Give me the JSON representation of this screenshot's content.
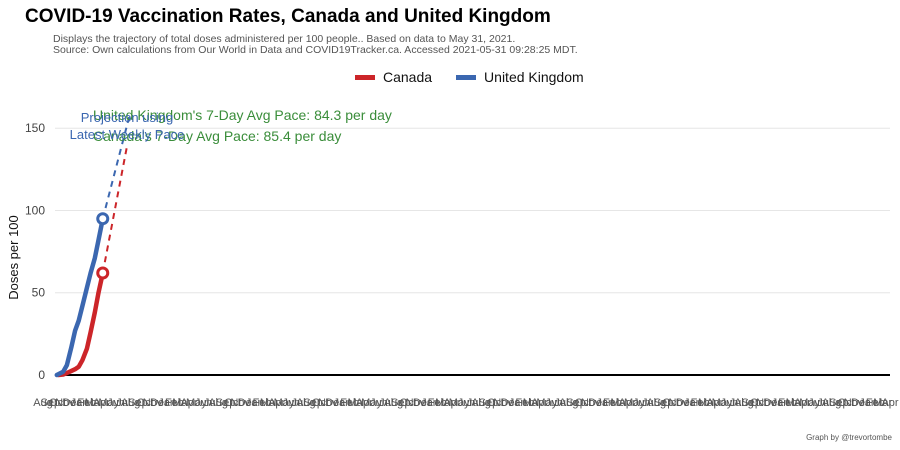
{
  "header": {
    "title": "COVID-19 Vaccination Rates, Canada and United Kingdom",
    "subtitle_line1": "Displays the trajectory of total doses administered per 100 people.. Based on data to May 31, 2021.",
    "subtitle_line2": "Source: Own calculations from Our World in Data and COVID19Tracker.ca. Accessed 2021-05-31 09:28:25 MDT."
  },
  "footer": {
    "caption": "Graph by @trevortombe"
  },
  "colors": {
    "canada": "#cc2529",
    "uk": "#3b67b0",
    "annotation": "#3a8d3a",
    "projection": "#3b67b0"
  },
  "chart_data": {
    "type": "line",
    "title": "COVID-19 Vaccination Rates, Canada and United Kingdom",
    "xlabel": "",
    "ylabel": "Doses per 100",
    "ylim": [
      0,
      155
    ],
    "y_ticks": [
      0,
      50,
      100,
      150
    ],
    "grid": true,
    "legend_position": "top",
    "x_ticks": [
      "Aug",
      "Sep",
      "Oct",
      "Nov",
      "Dec",
      "Jan",
      "Feb",
      "Mar",
      "Apr",
      "May",
      "Jun",
      "Jul",
      "Aug",
      "Sep",
      "Oct",
      "Nov",
      "Dec",
      "Jan",
      "Feb",
      "Mar",
      "Apr",
      "May",
      "Jun",
      "Jul",
      "Aug",
      "Sep",
      "Oct",
      "Nov",
      "Dec",
      "Jan",
      "Feb",
      "Mar",
      "Apr",
      "May",
      "Jun",
      "Jul",
      "Aug",
      "Sep",
      "Oct",
      "Nov",
      "Dec",
      "Jan",
      "Feb",
      "Mar",
      "Apr",
      "May",
      "Jun",
      "Jul",
      "Aug",
      "Sep",
      "Oct",
      "Nov",
      "Dec",
      "Jan",
      "Feb",
      "Mar",
      "Apr",
      "May",
      "Jun",
      "Jul",
      "Aug",
      "Sep",
      "Oct",
      "Nov",
      "Dec",
      "Jan",
      "Feb",
      "Mar",
      "Apr",
      "May",
      "Jun",
      "Jul",
      "Aug",
      "Sep",
      "Oct",
      "Nov",
      "Dec",
      "Jan",
      "Feb",
      "Mar",
      "Apr",
      "May",
      "Jun",
      "Jul",
      "Aug",
      "Sep",
      "Oct",
      "Nov",
      "Dec",
      "Jan",
      "Feb",
      "Mar",
      "Apr",
      "May",
      "Jun",
      "Jul",
      "Aug",
      "Sep",
      "Oct",
      "Nov",
      "Dec",
      "Jan",
      "Feb",
      "Mar",
      "Apr",
      "May",
      "Jun",
      "Jul",
      "Aug",
      "Sep",
      "Oct",
      "Nov",
      "Dec",
      "Jan",
      "Feb",
      "Mar",
      "Apr"
    ],
    "x_domain": [
      "2020-12-01",
      "2029-08-01"
    ],
    "series": [
      {
        "name": "Canada",
        "key": "canada",
        "dates": [
          "2020-12-14",
          "2021-01-01",
          "2021-01-15",
          "2021-02-01",
          "2021-02-15",
          "2021-03-01",
          "2021-03-15",
          "2021-04-01",
          "2021-04-15",
          "2021-05-01",
          "2021-05-15",
          "2021-05-31"
        ],
        "values": [
          0,
          0.3,
          1.2,
          2.5,
          3.5,
          5,
          9,
          16,
          26,
          38,
          50,
          62
        ],
        "projection": {
          "dates": [
            "2021-05-31",
            "2021-09-01"
          ],
          "values": [
            62,
            140
          ]
        }
      },
      {
        "name": "United Kingdom",
        "key": "uk",
        "dates": [
          "2020-12-08",
          "2021-01-01",
          "2021-01-15",
          "2021-02-01",
          "2021-02-15",
          "2021-03-01",
          "2021-03-15",
          "2021-04-01",
          "2021-04-15",
          "2021-05-01",
          "2021-05-15",
          "2021-05-31"
        ],
        "values": [
          0,
          2,
          6,
          17,
          27,
          33,
          42,
          53,
          62,
          71,
          82,
          95
        ],
        "projection": {
          "dates": [
            "2021-05-31",
            "2021-09-10"
          ],
          "values": [
            95,
            158
          ]
        }
      }
    ],
    "annotations": [
      {
        "text": "United Kingdom's 7-Day Avg Pace: 84.3 per day",
        "color": "annotation"
      },
      {
        "text": "Canada's 7-Day Avg Pace: 85.4 per day",
        "color": "annotation"
      },
      {
        "text": "Projection using",
        "color": "projection"
      },
      {
        "text": "Latest Weekly Pace",
        "color": "projection"
      }
    ]
  }
}
